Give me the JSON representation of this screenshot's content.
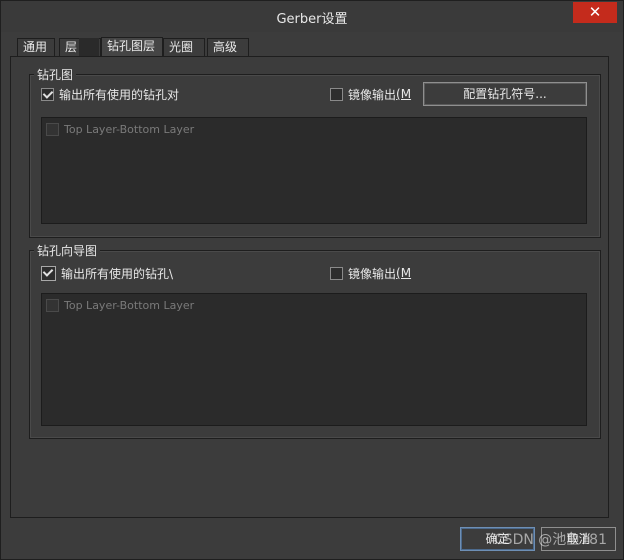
{
  "window": {
    "title": "Gerber设置",
    "close_glyph": "✕"
  },
  "tabs": [
    {
      "label": "通用",
      "active": false
    },
    {
      "label": "层",
      "active": false
    },
    {
      "label": "钻孔图层",
      "active": true
    },
    {
      "label": "光圈",
      "active": false
    },
    {
      "label": "高级",
      "active": false
    }
  ],
  "drill_drawing": {
    "title": "钻孔图",
    "output_all_pairs": {
      "label": "输出所有使用的钻孔对",
      "checked": true
    },
    "mirror_output": {
      "label": "镜像输出 ",
      "accel": "(M",
      "checked": false
    },
    "config_button": "配置钻孔符号...",
    "list": [
      {
        "label": "Top Layer-Bottom Layer",
        "checked": false
      }
    ]
  },
  "drill_guide": {
    "title": "钻孔向导图",
    "output_all_pairs": {
      "label": "输出所有使用的钻孔\\",
      "checked": true
    },
    "mirror_output": {
      "label": "镜像输出 ",
      "accel": "(M",
      "checked": false
    },
    "list": [
      {
        "label": "Top Layer-Bottom Layer",
        "checked": false
      }
    ]
  },
  "footer": {
    "ok": "确定",
    "cancel": "取消"
  },
  "watermark": "CSDN @池鱼181",
  "colors": {
    "background": "#3c3c3c",
    "list_background": "#2b2b2b",
    "close_button": "#c42b1c",
    "text": "#e8e8e8"
  }
}
